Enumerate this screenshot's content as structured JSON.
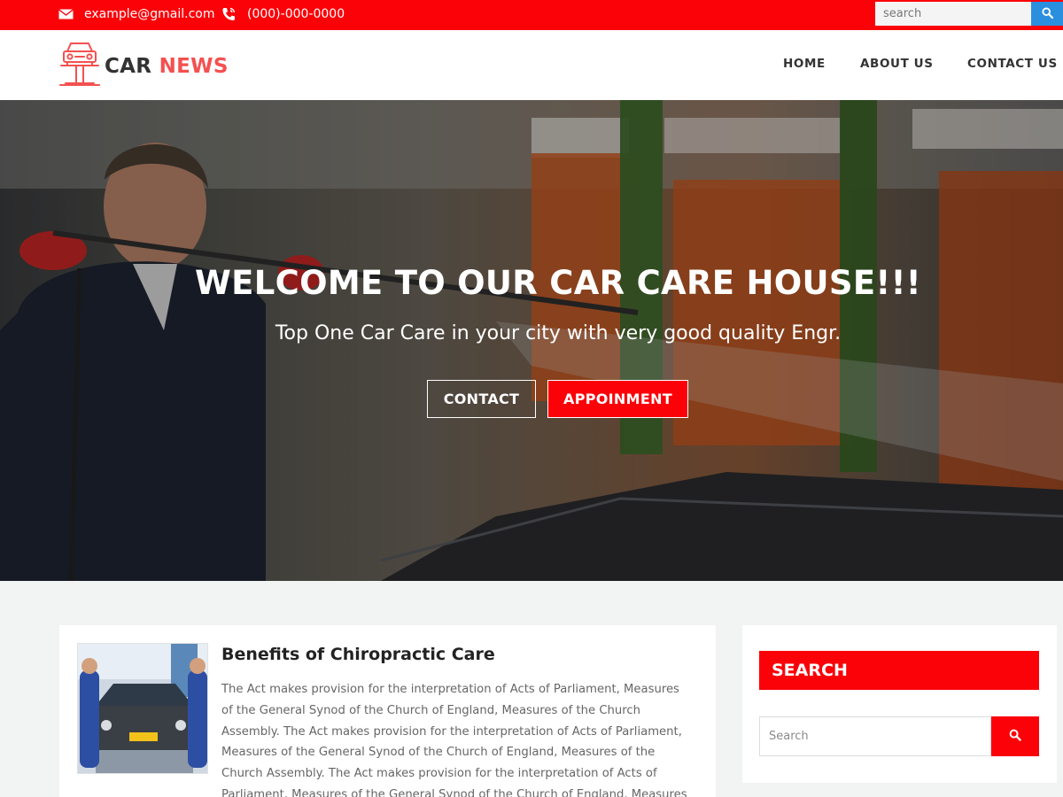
{
  "topbar": {
    "email": "example@gmail.com",
    "phone": "(000)-000-0000",
    "search_placeholder": "search",
    "color": "#fb0108",
    "search_button_color": "#2b8fe0"
  },
  "header": {
    "logo_word1": "CAR",
    "logo_word2": "NEWS",
    "logo_accent": "#f35150",
    "nav": [
      "HOME",
      "ABOUT US",
      "CONTACT US"
    ]
  },
  "hero": {
    "title": "WELCOME TO OUR CAR CARE HOUSE!!!",
    "subtitle": "Top One Car Care in your city with very good quality Engr.",
    "contact_label": "CONTACT",
    "appointment_label": "APPOINMENT"
  },
  "post": {
    "title": "Benefits of Chiropractic Care",
    "body": "The Act makes provision for the interpretation of Acts of Parliament, Measures of the General Synod of the Church of England, Measures of the Church Assembly. The Act makes provision for the interpretation of Acts of Parliament, Measures of the General Synod of the Church of England, Measures of the Church Assembly. The Act makes provision for the interpretation of Acts of Parliament, Measures of the General Synod of the Church of England, Measures of the Church Assembly."
  },
  "sidebar": {
    "search_title": "SEARCH",
    "search_placeholder": "Search"
  }
}
